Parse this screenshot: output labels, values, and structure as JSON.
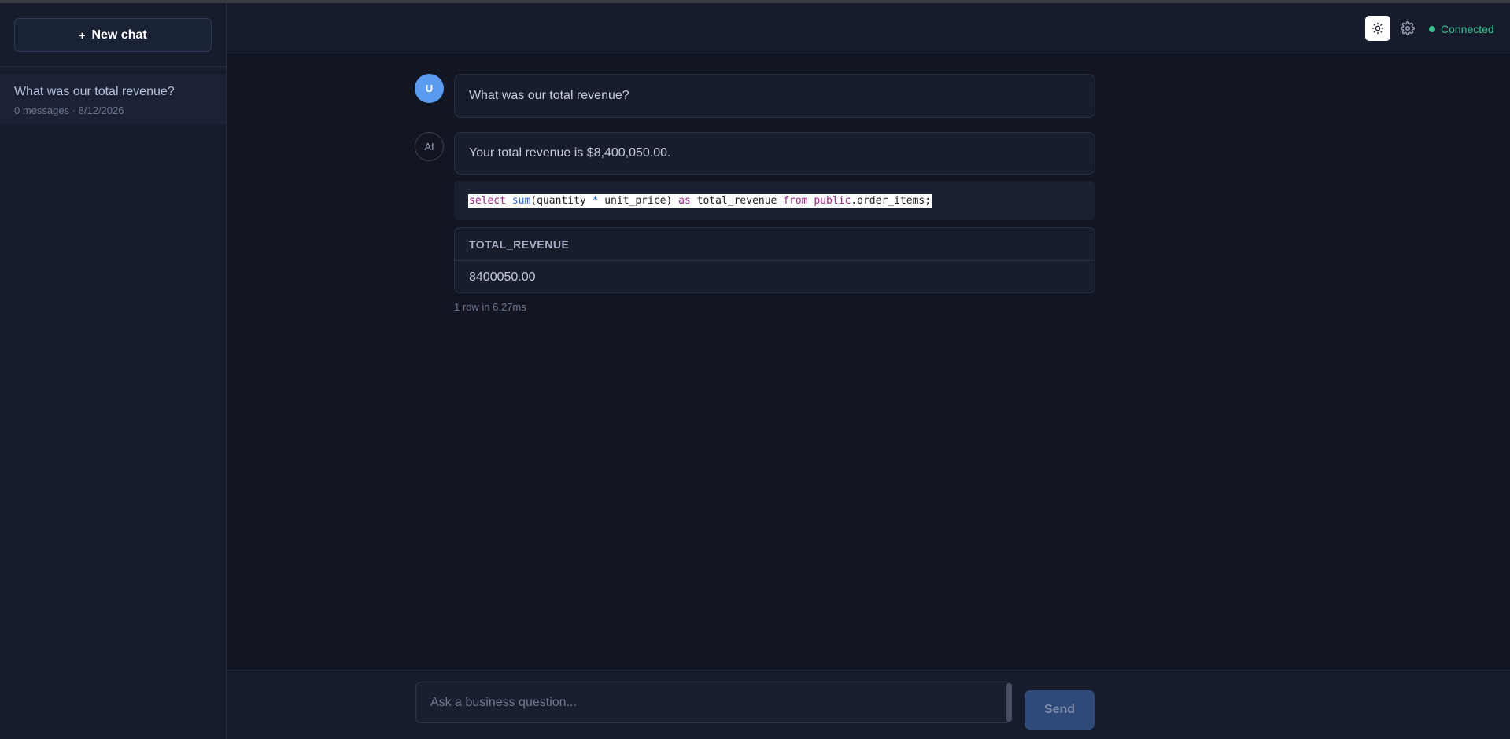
{
  "sidebar": {
    "new_chat_label": "New chat",
    "conversations": [
      {
        "title": "What was our total revenue?",
        "meta": "0 messages · 8/12/2026"
      }
    ]
  },
  "header": {
    "status_text": "Connected",
    "status_color": "#34c38f"
  },
  "messages": {
    "user_avatar": "U",
    "user_text": "What was our total revenue?",
    "ai_avatar": "AI",
    "ai_text": "Your total revenue is $8,400,050.00.",
    "sql": {
      "select": "select",
      "sum": "sum",
      "open": "(quantity ",
      "star": "*",
      "rest1": " unit_price) ",
      "as": "as",
      "alias": " total_revenue ",
      "from": "from",
      "space": " ",
      "public": "public",
      "table": ".order_items;"
    },
    "result": {
      "column": "TOTAL_REVENUE",
      "rows": [
        "8400050.00"
      ],
      "meta": "1 row in 6.27ms"
    }
  },
  "composer": {
    "placeholder": "Ask a business question...",
    "send_label": "Send"
  },
  "colors": {
    "accent": "#5b9cf3",
    "background": "#121522",
    "panel": "#171c2c"
  }
}
